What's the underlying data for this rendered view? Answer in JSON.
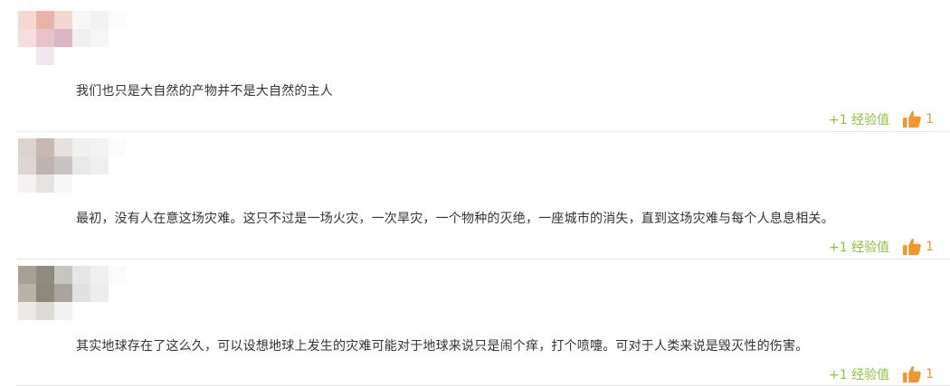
{
  "colors": {
    "xp_green": "#8fbf3f",
    "like_orange": "#f0962e",
    "divider": "#e6e6e6",
    "text": "#333333"
  },
  "comments": [
    {
      "avatar": "blurred-avatar",
      "avatar_palette": [
        "#f4d9d2",
        "#eab3aa",
        "#f3d7d2",
        "#f7f7f7",
        "#f2f2f2",
        "#fbfbfb",
        "#f7dede",
        "#e8c2cb",
        "#ddb6c6",
        "#efefef",
        "#f6f6f6",
        "#ffffff",
        "#ffffff",
        "#efe6ee",
        "#ffffff",
        "#ffffff",
        "#ffffff",
        "#ffffff"
      ],
      "text": "我们也只是大自然的产物并不是大自然的主人",
      "xp_label": "+1 经验值",
      "like_icon": "thumbs-up-icon",
      "like_count": "1"
    },
    {
      "avatar": "blurred-avatar",
      "avatar_palette": [
        "#dcd3cf",
        "#c9b8b2",
        "#e6e1de",
        "#f0f0f0",
        "#f3f3f3",
        "#fbfbfb",
        "#ded6d3",
        "#bfb3b0",
        "#c9c3c2",
        "#e8e8e8",
        "#efefef",
        "#ffffff",
        "#f4f1f0",
        "#e6e2e1",
        "#f7f7f7",
        "#ffffff",
        "#ffffff",
        "#ffffff"
      ],
      "text": "最初，没有人在意这场灾难。这只不过是一场火灾，一次旱灾，一个物种的灭绝，一座城市的消失，直到这场灾难与每个人息息相关。",
      "xp_label": "+1 经验值",
      "like_icon": "thumbs-up-icon",
      "like_count": "1"
    },
    {
      "avatar": "blurred-avatar",
      "avatar_palette": [
        "#a7a193",
        "#8f8a80",
        "#c7c5bf",
        "#e6e6e6",
        "#efefef",
        "#fbfbfb",
        "#b8b1a6",
        "#8e8878",
        "#a9a59c",
        "#e1e1e1",
        "#ececec",
        "#ffffff",
        "#ece9e4",
        "#dedad6",
        "#f2f2f2",
        "#ffffff",
        "#ffffff",
        "#ffffff"
      ],
      "text": "其实地球存在了这么久，可以设想地球上发生的灾难可能对于地球来说只是闹个痒，打个喷嚏。可对于人类来说是毁灭性的伤害。",
      "xp_label": "+1 经验值",
      "like_icon": "thumbs-up-icon",
      "like_count": "1"
    }
  ]
}
